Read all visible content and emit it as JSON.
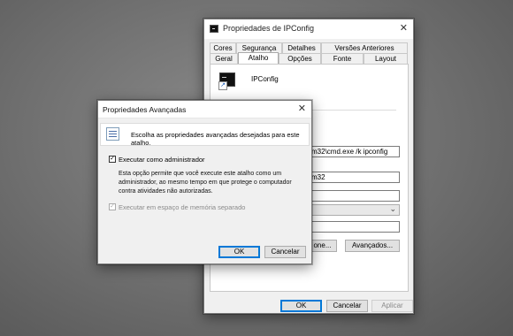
{
  "back_window": {
    "title": "Propriedades de IPConfig",
    "close_glyph": "✕",
    "tabs_row1": [
      "Cores",
      "Segurança",
      "Detalhes",
      "Versões Anteriores"
    ],
    "tabs_row2": [
      "Geral",
      "Atalho",
      "Opções",
      "Fonte",
      "Layout"
    ],
    "active_tab": "Atalho",
    "shortcut_name": "IPConfig",
    "target_value": "m32\\cmd.exe /k ipconfig",
    "start_in_value": "m32",
    "open_location_label": "one...",
    "advanced_label": "Avançados...",
    "ok_label": "OK",
    "cancel_label": "Cancelar",
    "apply_label": "Aplicar"
  },
  "dialog": {
    "title": "Propriedades Avançadas",
    "close_glyph": "✕",
    "info_text": "Escolha as propriedades avançadas desejadas para este atalho.",
    "run_as_admin": {
      "label": "Executar como administrador",
      "checked": true
    },
    "description": "Esta opção permite que você execute este atalho como um administrador, ao mesmo tempo em que protege o computador contra atividades não autorizadas.",
    "separate_memory": {
      "label": "Executar em espaço de memória separado",
      "checked": true,
      "disabled": true
    },
    "ok_label": "OK",
    "cancel_label": "Cancelar"
  },
  "icons": {
    "check_glyph": "✓",
    "dropdown_glyph": "⌄"
  },
  "colors": {
    "accent": "#0078d7",
    "desktop": "#6e6e6e"
  }
}
